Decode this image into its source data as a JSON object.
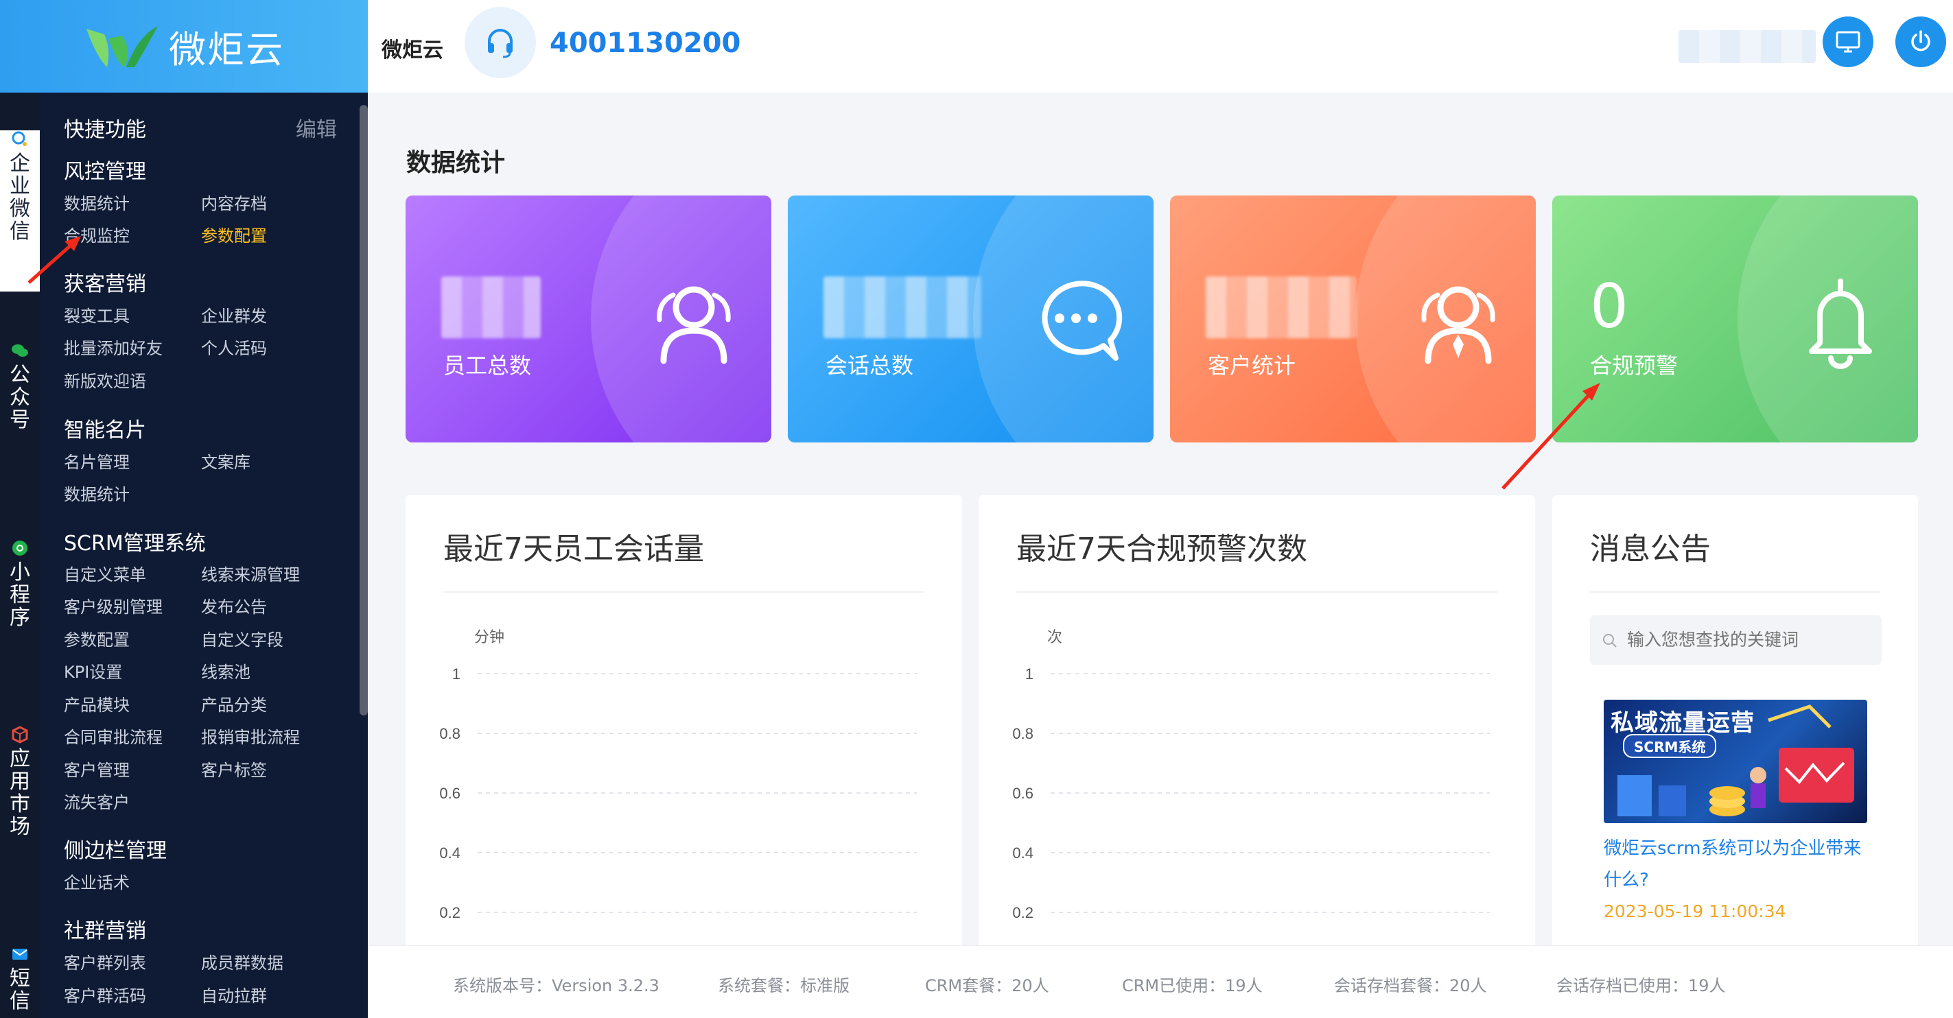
{
  "logo": {
    "text": "微炬云"
  },
  "rail": [
    {
      "label": "企业微信",
      "icon": "wecom-icon",
      "color": "#1d93ec"
    },
    {
      "label": "公众号",
      "icon": "wechat-icon",
      "color": "#22b14c"
    },
    {
      "label": "小程序",
      "icon": "mini-program-icon",
      "color": "#22b14c"
    },
    {
      "label": "应用市场",
      "icon": "app-market-icon",
      "color": "#e74c3c"
    },
    {
      "label": "短信",
      "icon": "sms-icon",
      "color": "#1d93ec"
    }
  ],
  "menu": {
    "edit_label": "编辑",
    "quick": {
      "title": "快捷功能"
    },
    "groups": [
      {
        "title": "风控管理",
        "items": [
          "数据统计",
          "内容存档",
          "合规监控",
          "参数配置"
        ]
      },
      {
        "title": "获客营销",
        "items": [
          "裂变工具",
          "企业群发",
          "批量添加好友",
          "个人活码",
          "新版欢迎语"
        ]
      },
      {
        "title": "智能名片",
        "items": [
          "名片管理",
          "文案库",
          "数据统计"
        ]
      },
      {
        "title": "SCRM管理系统",
        "items": [
          "自定义菜单",
          "线索来源管理",
          "客户级别管理",
          "发布公告",
          "参数配置",
          "自定义字段",
          "KPI设置",
          "线索池",
          "产品模块",
          "产品分类",
          "合同审批流程",
          "报销审批流程",
          "客户管理",
          "客户标签",
          "流失客户"
        ]
      },
      {
        "title": "侧边栏管理",
        "items": [
          "企业话术"
        ]
      },
      {
        "title": "社群营销",
        "items": [
          "客户群列表",
          "成员群数据",
          "客户群活码",
          "自动拉群"
        ]
      }
    ]
  },
  "header": {
    "brand": "微炬云",
    "phone": "4001130200"
  },
  "section_title": "数据统计",
  "cards": [
    {
      "label": "员工总数",
      "value": "",
      "icon": "users-icon"
    },
    {
      "label": "会话总数",
      "value": "",
      "icon": "chat-bubble-icon"
    },
    {
      "label": "客户统计",
      "value": "",
      "icon": "customer-icon"
    },
    {
      "label": "合规预警",
      "value": "0",
      "icon": "bell-icon"
    }
  ],
  "panels": {
    "chart1_title": "最近7天员工会话量",
    "chart2_title": "最近7天合规预警次数",
    "news_title": "消息公告"
  },
  "chart_data": [
    {
      "type": "line",
      "title": "最近7天员工会话量",
      "ylabel": "分钟",
      "ylim": [
        0,
        1
      ],
      "yticks": [
        "1",
        "0.8",
        "0.6",
        "0.4",
        "0.2"
      ],
      "grid": true,
      "series": []
    },
    {
      "type": "line",
      "title": "最近7天合规预警次数",
      "ylabel": "次",
      "ylim": [
        0,
        1
      ],
      "yticks": [
        "1",
        "0.8",
        "0.6",
        "0.4",
        "0.2"
      ],
      "grid": true,
      "series": []
    }
  ],
  "news": {
    "search_placeholder": "输入您想查找的关键词",
    "image_text_main": "私域流量运营",
    "image_text_sub": "SCRM系统",
    "item_title": "微炬云scrm系统可以为企业带来什么?",
    "item_date": "2023-05-19 11:00:34"
  },
  "footer": [
    "系统版本号：Version 3.2.3",
    "系统套餐：标准版",
    "CRM套餐：20人",
    "CRM已使用：19人",
    "会话存档套餐：20人",
    "会话存档已使用：19人"
  ]
}
